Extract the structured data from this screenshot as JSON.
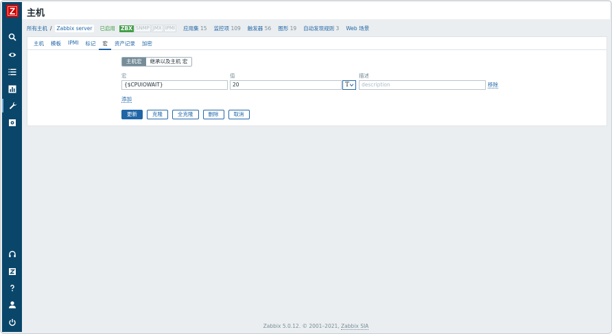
{
  "app": {
    "logo_letter": "Z"
  },
  "header": {
    "title": "主机"
  },
  "sidebar": {
    "top_icons": [
      "search-icon",
      "eye-icon",
      "list-icon",
      "chart-icon",
      "wrench-icon",
      "gear-icon"
    ],
    "bottom_icons": [
      "headset-icon",
      "zabbix-share-icon",
      "help-icon",
      "user-icon",
      "power-icon"
    ]
  },
  "breadcrumb": {
    "all_hosts": "所有主机",
    "separator": "/",
    "current_host": "Zabbix server",
    "status": "已启用",
    "badges": {
      "zbx": "ZBX",
      "snmp": "SNMP",
      "jmx": "JMX",
      "ipmi": "IPMI"
    },
    "counts": [
      {
        "label": "应用集",
        "value": "15"
      },
      {
        "label": "监控项",
        "value": "109"
      },
      {
        "label": "触发器",
        "value": "56"
      },
      {
        "label": "图形",
        "value": "19"
      },
      {
        "label": "自动发现规则",
        "value": "3"
      },
      {
        "label": "Web 场景",
        "value": ""
      }
    ]
  },
  "tabs": [
    "主机",
    "模板",
    "IPMI",
    "标记",
    "宏",
    "资产记录",
    "加密"
  ],
  "active_tab": "宏",
  "macro_view": {
    "host_macros": "主机宏",
    "inherited_macros": "继承以及主机 宏",
    "selected": "主机宏"
  },
  "columns": {
    "macro": "宏",
    "value": "值",
    "description": "描述"
  },
  "macro_row": {
    "macro": "{$CPUIOWAIT}",
    "value": "20",
    "type_glyph": "T",
    "description_placeholder": "description",
    "remove_label": "移除"
  },
  "add_label": "添加",
  "buttons": {
    "update": "更新",
    "clone": "克隆",
    "full_clone": "全克隆",
    "delete": "删除",
    "cancel": "取消"
  },
  "footer": {
    "version": "Zabbix 5.0.12. © 2001–2021,",
    "company": "Zabbix SIA"
  },
  "colors": {
    "sidebar": "#0a466a",
    "logo": "#d40000",
    "link": "#1f65a6",
    "enabled": "#429e47"
  }
}
